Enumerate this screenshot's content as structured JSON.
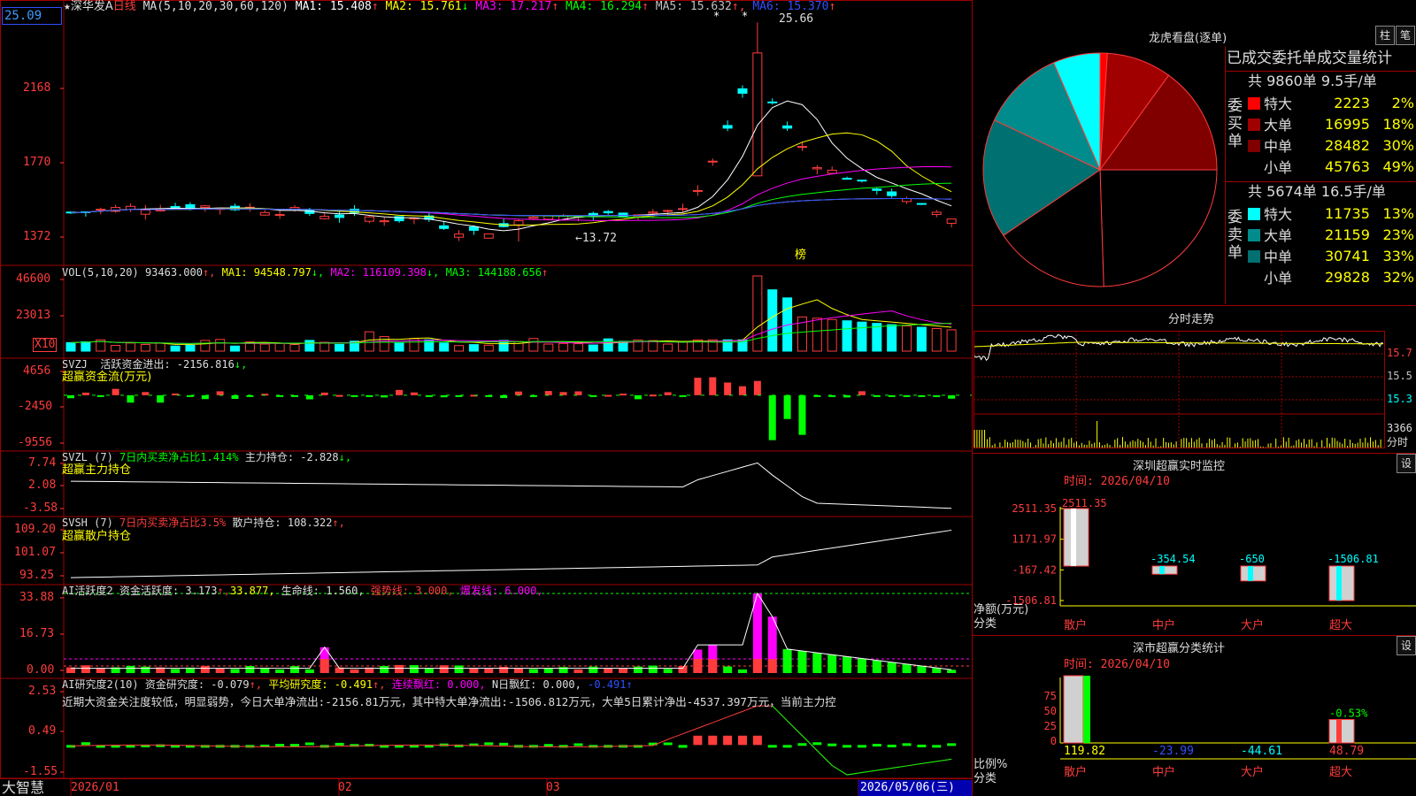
{
  "stock": {
    "name": "深华发A",
    "period": "日线",
    "price_box": "25.09",
    "star": "★"
  },
  "main_chart": {
    "ma_prefix": "MA(5,10,20,30,60,120)",
    "ma": [
      {
        "label": "MA1: 15.408",
        "arrow": "↑",
        "color": "#ffffff"
      },
      {
        "label": "MA2: 15.761",
        "arrow": "↓",
        "color": "#ffff00"
      },
      {
        "label": "MA3: 17.217",
        "arrow": "↑",
        "color": "#ff00ff"
      },
      {
        "label": "MA4: 16.294",
        "arrow": "↑",
        "color": "#00ff00"
      },
      {
        "label": "MA5: 15.632",
        "arrow": "↑,",
        "color": "#c0c0c0"
      },
      {
        "label": "MA6: 15.370",
        "arrow": "↑",
        "color": "#3050ff"
      }
    ],
    "y_labels": [
      "2168",
      "1770",
      "1372"
    ],
    "high_label": "25.66",
    "low_label": "←13.72",
    "bang_label": "榜",
    "ylim": [
      13.0,
      26.5
    ],
    "scale_hi": 2168,
    "scale_lo": 1372
  },
  "volume": {
    "prefix": "VOL(5,10,20)",
    "value": "93463.000",
    "ma": [
      {
        "label": "MA1: 94548.797",
        "arrow": "↓,",
        "color": "#ffff00"
      },
      {
        "label": "MA2: 116109.398",
        "arrow": "↓,",
        "color": "#ff00ff"
      },
      {
        "label": "MA3: 144188.656",
        "arrow": "↑",
        "color": "#00ff00"
      }
    ],
    "y_labels": [
      "46600",
      "23013"
    ],
    "unit": "X10",
    "ymax": 46600
  },
  "svzj": {
    "prefix": "SVZJ",
    "desc": "活跃资金进出: -2156.816",
    "arrow": "↓,",
    "sub": "超赢资金流(万元)",
    "y_labels": [
      "4656",
      "-2450",
      "-9556"
    ],
    "ymax": 4656,
    "ymin": -9556
  },
  "svzl": {
    "prefix": "SVZL (7)",
    "desc1": "7日内买卖净占比1.414%",
    "desc2": "主力持仓: -2.828",
    "arrow": "↓,",
    "sub": "超赢主力持仓",
    "y_labels": [
      "7.74",
      "2.08",
      "-3.58"
    ],
    "ymax": 7.74,
    "ymin": -3.58
  },
  "svsh": {
    "prefix": "SVSH (7)",
    "desc1": "7日内买卖净占比3.5%",
    "desc2": "散户持仓: 108.322",
    "arrow": "↑,",
    "sub": "超赢散户持仓",
    "y_labels": [
      "109.20",
      "101.07",
      "93.25"
    ],
    "ymax": 109.2,
    "ymin": 93.25
  },
  "ai_active": {
    "prefix": "AI活跃度2",
    "desc1": "资金活跃度: 3.173",
    "arrow1": "↑,",
    "desc2": "33.877,",
    "desc3": "生命线: 1.560,",
    "desc4": "强势线: 3.000,",
    "desc5": "爆发线: 6.000,",
    "y_labels": [
      "33.88",
      "16.73",
      "0.00"
    ],
    "ymax": 33.88
  },
  "ai_research": {
    "prefix": "AI研究度2(10)",
    "desc1": "资金研究度: -0.079",
    "arrow1": "↑,",
    "desc2": "平均研究度: -0.491",
    "arrow2": "↑,",
    "desc3": "连续飘红: 0.000,",
    "desc4": "N日飘红: 0.000,",
    "desc5": "-0.491",
    "arrow5": "↑",
    "comment": "近期大资金关注度较低，明显弱势，今日大单净流出:-2156.81万元，其中特大单净流出:-1506.812万元，大单5日累计净出-4537.397万元，当前主力控",
    "y_labels": [
      "2.53",
      "0.49",
      "-1.55"
    ],
    "ymax": 2.53,
    "ymin": -1.55
  },
  "date_axis": {
    "app_name": "大智慧",
    "dates": [
      "2026/01",
      "02",
      "03"
    ],
    "current": "2026/05/06(三)"
  },
  "dragon_tiger": {
    "title": "龙虎看盘(逐单)",
    "btn_bar": "柱",
    "btn_pen": "笔",
    "header": "已成交委托单成交量统计",
    "buy_label": "委买单",
    "buy_summary": "共 9860单 9.5手/单",
    "sell_label": "委卖单",
    "sell_summary": "共 5674单 16.5手/单",
    "buy": [
      {
        "name": "特大",
        "vol": "2223",
        "pct": "2%",
        "color": "#ff0000"
      },
      {
        "name": "大单",
        "vol": "16995",
        "pct": "18%",
        "color": "#a00000"
      },
      {
        "name": "中单",
        "vol": "28482",
        "pct": "30%",
        "color": "#800000"
      },
      {
        "name": "小单",
        "vol": "45763",
        "pct": "49%",
        "color": "#000000"
      }
    ],
    "sell": [
      {
        "name": "特大",
        "vol": "11735",
        "pct": "13%",
        "color": "#00ffff"
      },
      {
        "name": "大单",
        "vol": "21159",
        "pct": "23%",
        "color": "#008c8c"
      },
      {
        "name": "中单",
        "vol": "30741",
        "pct": "33%",
        "color": "#007070"
      },
      {
        "name": "小单",
        "vol": "29828",
        "pct": "32%",
        "color": "#000000"
      }
    ]
  },
  "intraday": {
    "title": "分时走势",
    "y_labels": [
      "15.7",
      "15.5",
      "15.3"
    ],
    "vol_label": "3366",
    "vol_unit": "分时"
  },
  "sz_monitor": {
    "title": "深圳超赢实时监控",
    "btn": "设",
    "time": "时间: 2026/04/10",
    "y_labels": [
      "2511.35",
      "1171.97",
      "-167.42",
      "-1506.81"
    ],
    "y_title": "净额(万元)",
    "x_title": "分类",
    "ymax": 2511.35,
    "ymin": -1506.81,
    "bars": [
      {
        "cat": "散户",
        "value": 2511.35,
        "label": "2511.35"
      },
      {
        "cat": "中户",
        "value": -354.54,
        "label": "-354.54"
      },
      {
        "cat": "大户",
        "value": -650,
        "label": "-650"
      },
      {
        "cat": "超大",
        "value": -1506.81,
        "label": "-1506.81"
      }
    ]
  },
  "sz_class": {
    "title": "深市超赢分类统计",
    "btn": "设",
    "time": "时间: 2026/04/10",
    "y_labels": [
      "75",
      "50",
      "25",
      "0"
    ],
    "y_title": "比例%",
    "x_title": "分类",
    "top_label": "-0.53%",
    "bars": [
      {
        "cat": "散户",
        "value": 119.82,
        "label": "119.82",
        "color": "#ffff00"
      },
      {
        "cat": "中户",
        "value": -23.99,
        "label": "-23.99",
        "color": "#3050ff"
      },
      {
        "cat": "大户",
        "value": -44.61,
        "label": "-44.61",
        "color": "#00ffff"
      },
      {
        "cat": "超大",
        "value": 48.79,
        "label": "48.79",
        "color": "#ff3c3c"
      }
    ]
  }
}
